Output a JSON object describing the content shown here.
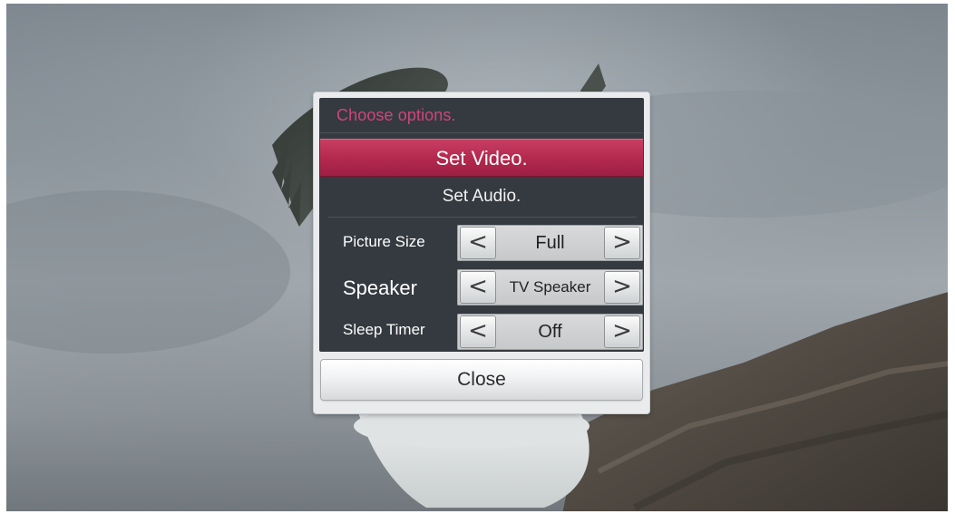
{
  "dialog": {
    "title": "Choose options.",
    "menu": {
      "set_video": "Set Video.",
      "set_audio": "Set Audio."
    },
    "settings": [
      {
        "label": "Picture Size",
        "value": "Full"
      },
      {
        "label": "Speaker",
        "value": "TV Speaker"
      },
      {
        "label": "Sleep Timer",
        "value": "Off"
      }
    ],
    "arrows": {
      "left": "<",
      "right": ">"
    },
    "close_label": "Close"
  },
  "colors": {
    "accent": "#b42a4f",
    "title_text": "#d0457a",
    "panel_bg": "#353a40"
  },
  "icons": {
    "decrement": "chevron-left-icon",
    "increment": "chevron-right-icon"
  }
}
